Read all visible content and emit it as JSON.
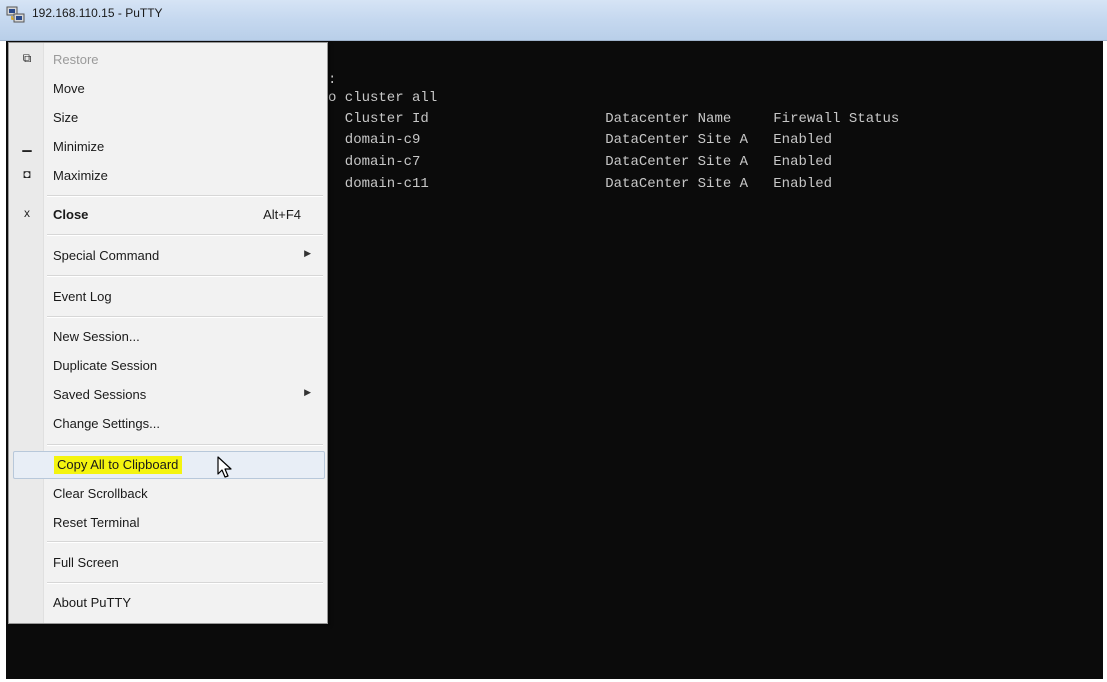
{
  "window": {
    "title": "192.168.110.15 - PuTTY"
  },
  "terminal": {
    "lines": [
      ":",
      "o cluster all",
      "  Cluster Id                     Datacenter Name     Firewall Status",
      "  domain-c9                      DataCenter Site A   Enabled",
      "  domain-c7                      DataCenter Site A   Enabled",
      "  domain-c11                     DataCenter Site A   Enabled"
    ]
  },
  "menu": {
    "items": [
      {
        "label": "Restore",
        "icon": "restore-icon",
        "glyph": "⧉",
        "disabled": true
      },
      {
        "label": "Move"
      },
      {
        "label": "Size"
      },
      {
        "label": "Minimize",
        "icon": "minimize-icon",
        "glyph": "▁"
      },
      {
        "label": "Maximize",
        "icon": "maximize-icon",
        "glyph": "◘"
      },
      {
        "label": "Close",
        "icon": "close-icon",
        "glyph": "x",
        "accelerator": "Alt+F4",
        "bold": true
      },
      {
        "label": "Special Command",
        "submenu": true
      },
      {
        "label": "Event Log"
      },
      {
        "label": "New Session..."
      },
      {
        "label": "Duplicate Session"
      },
      {
        "label": "Saved Sessions",
        "submenu": true
      },
      {
        "label": "Change Settings..."
      },
      {
        "label": "Copy All to Clipboard",
        "highlighted": true
      },
      {
        "label": "Clear Scrollback"
      },
      {
        "label": "Reset Terminal"
      },
      {
        "label": "Full Screen"
      },
      {
        "label": "About PuTTY"
      }
    ],
    "submenu_arrow": "▶"
  },
  "colors": {
    "terminal_bg": "#0b0b0b",
    "terminal_text": "#c7c7c7",
    "highlight": "#f4f40f"
  }
}
